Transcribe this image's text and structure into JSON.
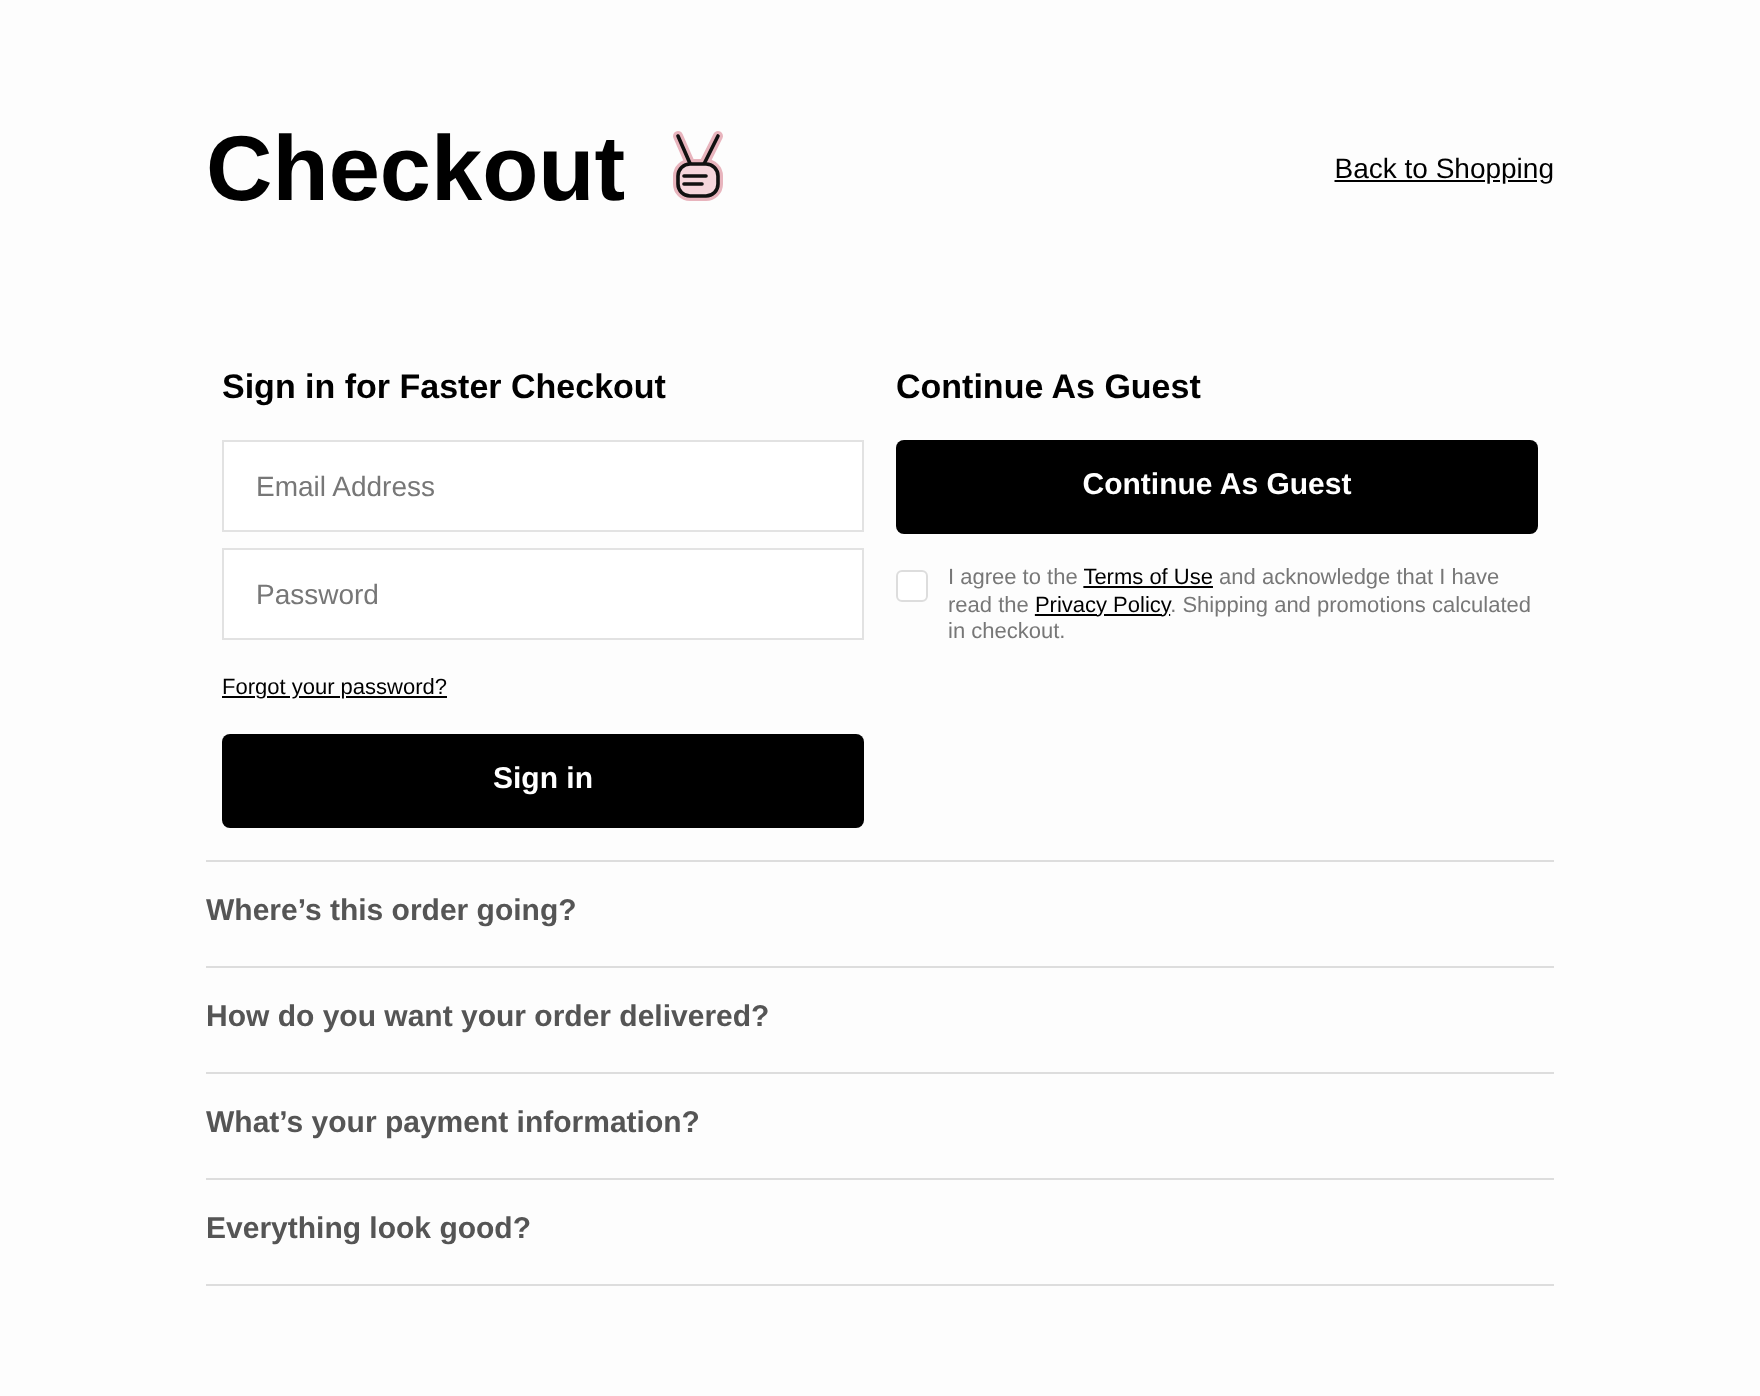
{
  "title": "Checkout",
  "back_link": "Back to Shopping",
  "sign_in": {
    "heading": "Sign in for Faster Checkout",
    "email": {
      "placeholder": "Email Address"
    },
    "password": {
      "placeholder": "Password"
    },
    "forgot_link": "Forgot your password?",
    "button": "Sign in"
  },
  "guest": {
    "heading": "Continue As Guest",
    "button": "Continue As Guest",
    "agreement": {
      "checked": false,
      "before": "I agree to the",
      "terms_link": "Terms of Use",
      "middle": "and acknowledge that I have read the",
      "privacy_link": "Privacy Policy",
      "after": ". Shipping and promotions calculated in checkout."
    }
  },
  "sections": [
    {
      "label": "Where’s this order going?",
      "expanded": false
    },
    {
      "label": "How do you want your order delivered?",
      "expanded": false
    },
    {
      "label": "What’s your payment information?",
      "expanded": false
    },
    {
      "label": "Everything look good?",
      "expanded": false
    }
  ]
}
